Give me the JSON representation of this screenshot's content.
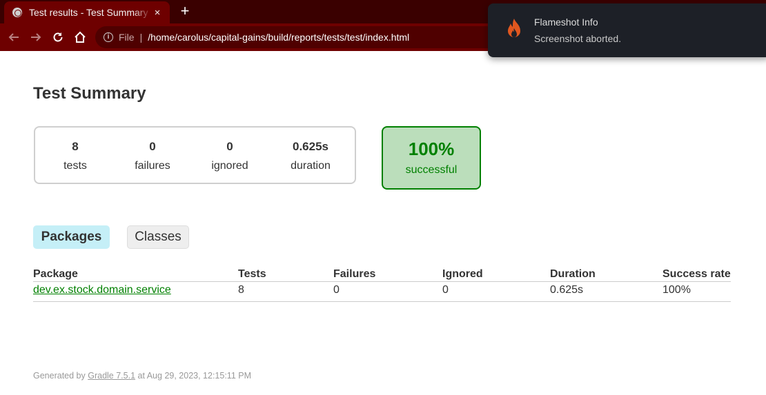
{
  "browser": {
    "tab_title": "Test results - Test Summary",
    "close_symbol": "×",
    "new_tab_symbol": "+",
    "file_label": "File",
    "url": "/home/carolus/capital-gains/build/reports/tests/test/index.html",
    "theme_colors": {
      "tabbar": "#3a0000",
      "toolbar": "#6e0000"
    }
  },
  "notification": {
    "app": "Flameshot Info",
    "message": "Screenshot aborted.",
    "icon": "flameshot-icon"
  },
  "page": {
    "title": "Test Summary"
  },
  "summary": {
    "tests": {
      "value": "8",
      "label": "tests"
    },
    "failures": {
      "value": "0",
      "label": "failures"
    },
    "ignored": {
      "value": "0",
      "label": "ignored"
    },
    "duration": {
      "value": "0.625s",
      "label": "duration"
    },
    "success": {
      "value": "100%",
      "label": "successful",
      "color": "#008000"
    }
  },
  "tabs": [
    {
      "label": "Packages",
      "selected": true
    },
    {
      "label": "Classes",
      "selected": false
    }
  ],
  "table": {
    "headers": [
      "Package",
      "Tests",
      "Failures",
      "Ignored",
      "Duration",
      "Success rate"
    ],
    "rows": [
      {
        "package": "dev.ex.stock.domain.service",
        "tests": "8",
        "failures": "0",
        "ignored": "0",
        "duration": "0.625s",
        "success_rate": "100%"
      }
    ]
  },
  "footer": {
    "prefix": "Generated by",
    "link": "Gradle 7.5.1",
    "suffix": "at Aug 29, 2023, 12:15:11 PM"
  }
}
